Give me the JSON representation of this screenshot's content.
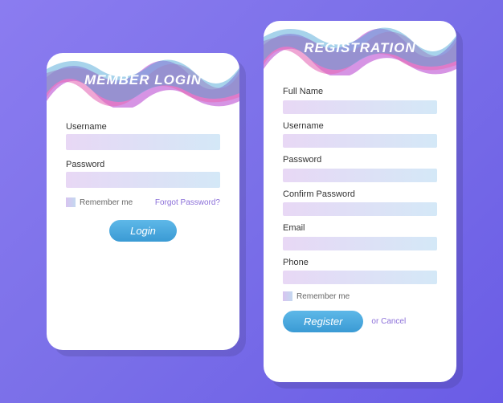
{
  "login": {
    "title": "MEMBER LOGIN",
    "username_label": "Username",
    "password_label": "Password",
    "remember_label": "Remember me",
    "forgot_label": "Forgot Password?",
    "button_label": "Login"
  },
  "register": {
    "title": "REGISTRATION",
    "fullname_label": "Full Name",
    "username_label": "Username",
    "password_label": "Password",
    "confirm_label": "Confirm Password",
    "email_label": "Email",
    "phone_label": "Phone",
    "remember_label": "Remember me",
    "button_label": "Register",
    "cancel_label": "or Cancel"
  }
}
